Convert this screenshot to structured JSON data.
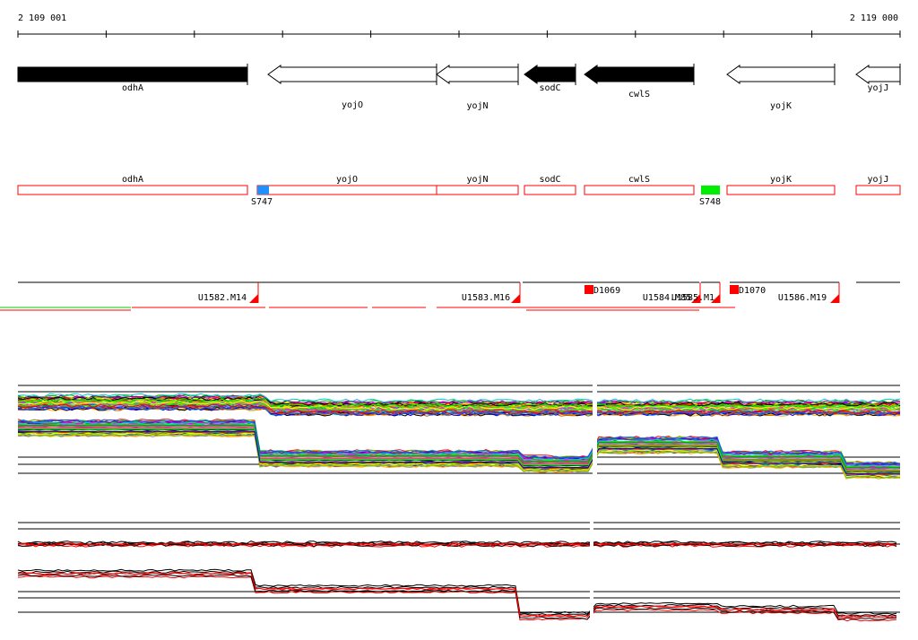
{
  "ruler": {
    "start_label": "2 109 001",
    "end_label": "2 119 000"
  },
  "genes": [
    {
      "name": "odhA",
      "strand": "+",
      "fill": "#000000"
    },
    {
      "name": "yojO",
      "strand": "-",
      "fill": "#ffffff"
    },
    {
      "name": "yojN",
      "strand": "-",
      "fill": "#ffffff"
    },
    {
      "name": "sodC",
      "strand": "-",
      "fill": "#000000"
    },
    {
      "name": "cwlS",
      "strand": "-",
      "fill": "#000000"
    },
    {
      "name": "yojK",
      "strand": "-",
      "fill": "#ffffff"
    },
    {
      "name": "yojJ",
      "strand": "-",
      "fill": "#ffffff"
    }
  ],
  "features": [
    {
      "label": "S747",
      "color": "#1e90ff"
    },
    {
      "label": "S748",
      "color": "#00ee00"
    }
  ],
  "transcripts": [
    "U1582.M14",
    "U1583.M16",
    "U1584.M85",
    "U1585.M1",
    "U1586.M19"
  ],
  "downs": [
    "D1069",
    "D1070"
  ],
  "colors": {
    "outline": "#ff0000",
    "line": "#000000"
  }
}
